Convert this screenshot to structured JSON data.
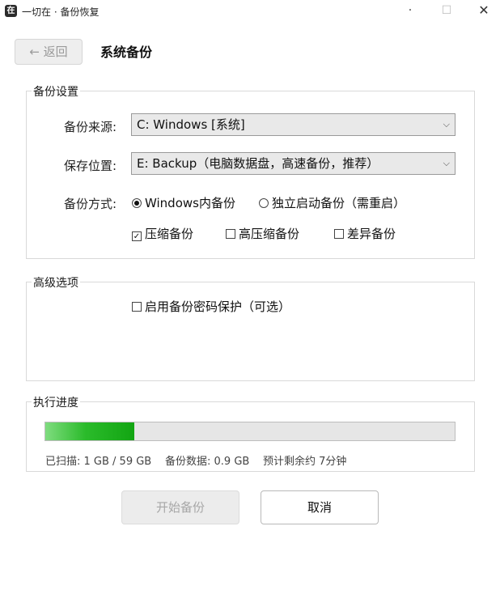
{
  "window": {
    "icon_text": "在",
    "title": "一切在 · 备份恢复",
    "min_glyph": "·",
    "max_glyph": "☐",
    "close_glyph": "✕"
  },
  "header": {
    "back_label": "← 返回",
    "page_title": "系统备份"
  },
  "settings": {
    "group_title": "备份设置",
    "source_label": "备份来源:",
    "source_value": "C: Windows [系统]",
    "target_label": "保存位置:",
    "target_value": "E: Backup（电脑数据盘，高速备份，推荐）",
    "method_label": "备份方式:",
    "method_options": [
      {
        "label": "Windows内备份",
        "selected": true
      },
      {
        "label": "独立启动备份（需重启）",
        "selected": false
      }
    ],
    "compress_options": [
      {
        "label": "压缩备份",
        "checked": true
      },
      {
        "label": "高压缩备份",
        "checked": false
      },
      {
        "label": "差异备份",
        "checked": false
      }
    ],
    "chevron_glyph": "⌵"
  },
  "advanced": {
    "group_title": "高级选项",
    "password_option": {
      "label": "启用备份密码保护（可选）",
      "checked": false
    }
  },
  "progress": {
    "group_title": "执行进度",
    "fraction": 0.217,
    "scanned": "已扫描: 1 GB / 59 GB",
    "backup_data": "备份数据: 0.9 GB",
    "remaining": "预计剩余约 7分钟",
    "fill_color": "#2bbb2b"
  },
  "actions": {
    "start_label": "开始备份",
    "cancel_label": "取消"
  },
  "icons": {
    "app": "app-logo-icon",
    "dropdown": "chevron-down-icon",
    "check": "checkmark-icon"
  }
}
